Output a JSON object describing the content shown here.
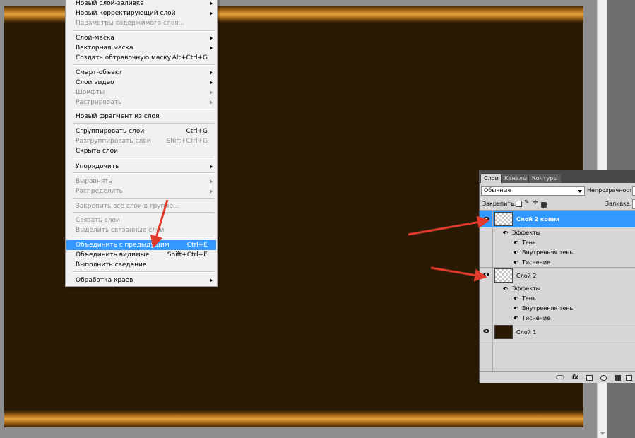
{
  "menu": {
    "items": [
      {
        "label": "Новый слой-заливка",
        "shortcut": "",
        "submenu": true,
        "disabled": false,
        "highlighted": false
      },
      {
        "label": "Новый корректирующий слой",
        "shortcut": "",
        "submenu": true,
        "disabled": false,
        "highlighted": false
      },
      {
        "label": "Параметры содержимого слоя...",
        "shortcut": "",
        "submenu": false,
        "disabled": true,
        "highlighted": false
      },
      {
        "label": "Слой-маска",
        "shortcut": "",
        "submenu": true,
        "disabled": false,
        "highlighted": false
      },
      {
        "label": "Векторная маска",
        "shortcut": "",
        "submenu": true,
        "disabled": false,
        "highlighted": false
      },
      {
        "label": "Создать обтравочную маску",
        "shortcut": "Alt+Ctrl+G",
        "submenu": false,
        "disabled": false,
        "highlighted": false
      },
      {
        "label": "Смарт-объект",
        "shortcut": "",
        "submenu": true,
        "disabled": false,
        "highlighted": false
      },
      {
        "label": "Слои видео",
        "shortcut": "",
        "submenu": true,
        "disabled": false,
        "highlighted": false
      },
      {
        "label": "Шрифты",
        "shortcut": "",
        "submenu": true,
        "disabled": true,
        "highlighted": false
      },
      {
        "label": "Растрировать",
        "shortcut": "",
        "submenu": true,
        "disabled": true,
        "highlighted": false
      },
      {
        "label": "Новый фрагмент из слоя",
        "shortcut": "",
        "submenu": false,
        "disabled": false,
        "highlighted": false
      },
      {
        "label": "Сгруппировать слои",
        "shortcut": "Ctrl+G",
        "submenu": false,
        "disabled": false,
        "highlighted": false
      },
      {
        "label": "Разгруппировать слои",
        "shortcut": "Shift+Ctrl+G",
        "submenu": false,
        "disabled": true,
        "highlighted": false
      },
      {
        "label": "Скрыть слои",
        "shortcut": "",
        "submenu": false,
        "disabled": false,
        "highlighted": false
      },
      {
        "label": "Упорядочить",
        "shortcut": "",
        "submenu": true,
        "disabled": false,
        "highlighted": false
      },
      {
        "label": "Выровнять",
        "shortcut": "",
        "submenu": true,
        "disabled": true,
        "highlighted": false
      },
      {
        "label": "Распределить",
        "shortcut": "",
        "submenu": true,
        "disabled": true,
        "highlighted": false
      },
      {
        "label": "Закрепить все слои в группе...",
        "shortcut": "",
        "submenu": false,
        "disabled": true,
        "highlighted": false
      },
      {
        "label": "Связать слои",
        "shortcut": "",
        "submenu": false,
        "disabled": true,
        "highlighted": false
      },
      {
        "label": "Выделить связанные слои",
        "shortcut": "",
        "submenu": false,
        "disabled": true,
        "highlighted": false
      },
      {
        "label": "Объединить с предыдущим",
        "shortcut": "Ctrl+E",
        "submenu": false,
        "disabled": false,
        "highlighted": true
      },
      {
        "label": "Объединить видимые",
        "shortcut": "Shift+Ctrl+E",
        "submenu": false,
        "disabled": false,
        "highlighted": false
      },
      {
        "label": "Выполнить сведение",
        "shortcut": "",
        "submenu": false,
        "disabled": false,
        "highlighted": false
      },
      {
        "label": "Обработка краев",
        "shortcut": "",
        "submenu": true,
        "disabled": false,
        "highlighted": false
      }
    ]
  },
  "panel": {
    "tabs": [
      "Слои",
      "Каналы",
      "Контуры"
    ],
    "blend_mode": "Обычные",
    "opacity_label": "Непрозрачность:",
    "opacity_value": "",
    "lock_label": "Закрепить:",
    "fill_label": "Заливка:",
    "fill_value": "",
    "layers": [
      {
        "name": "Слой 2 копия",
        "selected": true,
        "effects_label": "Эффекты",
        "effects": [
          "Тень",
          "Внутренняя тень",
          "Тиснение"
        ]
      },
      {
        "name": "Слой 2",
        "selected": false,
        "effects_label": "Эффекты",
        "effects": [
          "Тень",
          "Внутренняя тень",
          "Тиснение"
        ]
      },
      {
        "name": "Слой 1",
        "selected": false,
        "effects_label": "",
        "effects": []
      }
    ]
  },
  "colors": {
    "canvas": "#2a1a04",
    "gold": "#e4a23f",
    "highlight": "#3399ff",
    "arrow": "#e03a2c"
  },
  "icons": [
    "eye-icon",
    "link-icon",
    "fx-icon",
    "mask-icon",
    "adjustment-icon",
    "folder-icon",
    "new-layer-icon",
    "trash-icon",
    "lock-icon",
    "brush-icon",
    "move-icon"
  ]
}
